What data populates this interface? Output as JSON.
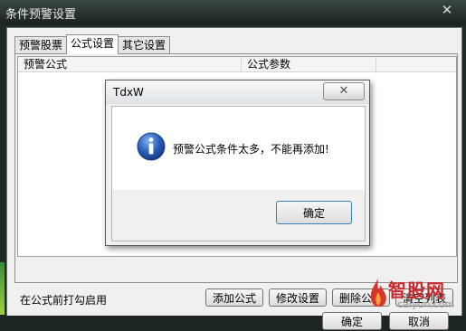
{
  "window": {
    "title": "条件预警设置",
    "close_glyph": "✕"
  },
  "tabs": [
    {
      "label": "预警股票",
      "active": false
    },
    {
      "label": "公式设置",
      "active": true
    },
    {
      "label": "其它设置",
      "active": false
    }
  ],
  "list": {
    "columns": [
      "预警公式",
      "公式参数"
    ]
  },
  "hint": "在公式前打勾启用",
  "buttons": {
    "add": "添加公式",
    "modify": "修改设置",
    "delete": "删除公式",
    "clear": "清空列表",
    "ok": "确定",
    "cancel": "取消"
  },
  "dialog": {
    "title": "TdxW",
    "close_glyph": "✕",
    "message": "预警公式条件太多，不能再添加!",
    "ok": "确定",
    "icon": "info-icon"
  },
  "watermark": {
    "text": "智股网",
    "url": "caiyun.com"
  },
  "colors": {
    "info_blue": "#2a5cb8",
    "watermark_red": "#c9282c"
  }
}
